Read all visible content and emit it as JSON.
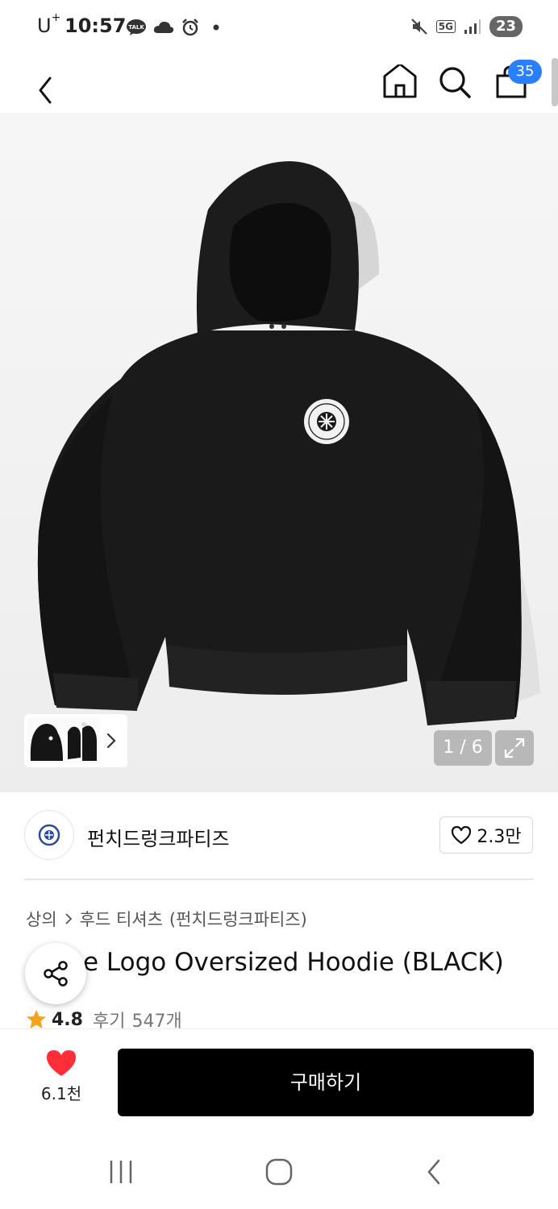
{
  "status_bar": {
    "carrier": "U",
    "carrier_sup": "+",
    "time": "10:57",
    "network": "5G",
    "battery": "23",
    "left_icons": [
      "talk-icon",
      "cloud-icon",
      "alarm-icon",
      "dot-icon"
    ],
    "right_icons": [
      "mute-icon",
      "network-5g-icon",
      "signal-icon",
      "battery-icon"
    ]
  },
  "header": {
    "cart_count": "35",
    "icons": [
      "back-icon",
      "home-icon",
      "search-icon",
      "cart-icon"
    ]
  },
  "gallery": {
    "current_page": "1 / 6",
    "icons": [
      "chevron-right-icon",
      "expand-icon"
    ]
  },
  "brand": {
    "name": "펀치드렁크파티즈",
    "likes": "2.3만",
    "icons": [
      "brand-logo",
      "heart-outline-icon"
    ]
  },
  "product": {
    "breadcrumb": [
      "상의",
      "후드 티셔츠",
      "(펀치드렁크파티즈)"
    ],
    "title": "Circle Logo Oversized Hoodie (BLACK)",
    "title_visible": "e Logo Oversized Hoodie (BLACK)",
    "rating": "4.8",
    "reviews_label": "후기",
    "reviews_count": "547개"
  },
  "bottom_bar": {
    "like_count": "6.1천",
    "buy_label": "구매하기",
    "colors": {
      "heart": "#ff2e38",
      "buy_bg": "#000000"
    }
  },
  "nav_bar": {
    "icons": [
      "recent-apps-icon",
      "home-button-icon",
      "back-button-icon"
    ]
  }
}
